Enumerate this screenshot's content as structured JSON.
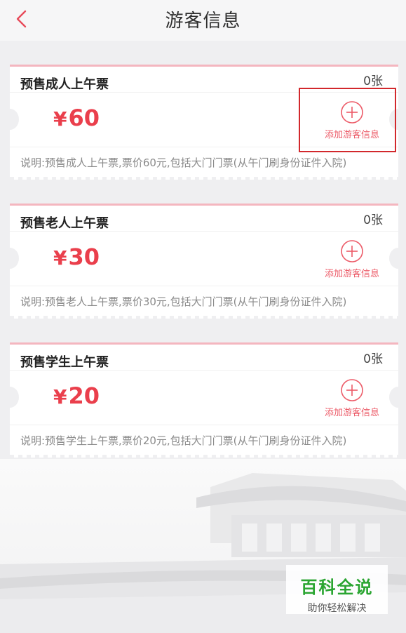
{
  "header": {
    "title": "游客信息"
  },
  "tickets": [
    {
      "name": "预售成人上午票",
      "count": "0张",
      "currency": "¥",
      "price": "60",
      "add_label": "添加游客信息",
      "description": "说明:预售成人上午票,票价60元,包括大门门票(从午门刷身份证件入院)"
    },
    {
      "name": "预售老人上午票",
      "count": "0张",
      "currency": "¥",
      "price": "30",
      "add_label": "添加游客信息",
      "description": "说明:预售老人上午票,票价30元,包括大门门票(从午门刷身份证件入院)"
    },
    {
      "name": "预售学生上午票",
      "count": "0张",
      "currency": "¥",
      "price": "20",
      "add_label": "添加游客信息",
      "description": "说明:预售学生上午票,票价20元,包括大门门票(从午门刷身份证件入院)"
    }
  ],
  "watermark": {
    "title": "百科全说",
    "subtitle": "助你轻松解决"
  },
  "colors": {
    "accent": "#ea3f4c",
    "ticket_top_border": "#f4b6bf",
    "highlight": "#d2282c",
    "watermark_green": "#2aa531"
  }
}
